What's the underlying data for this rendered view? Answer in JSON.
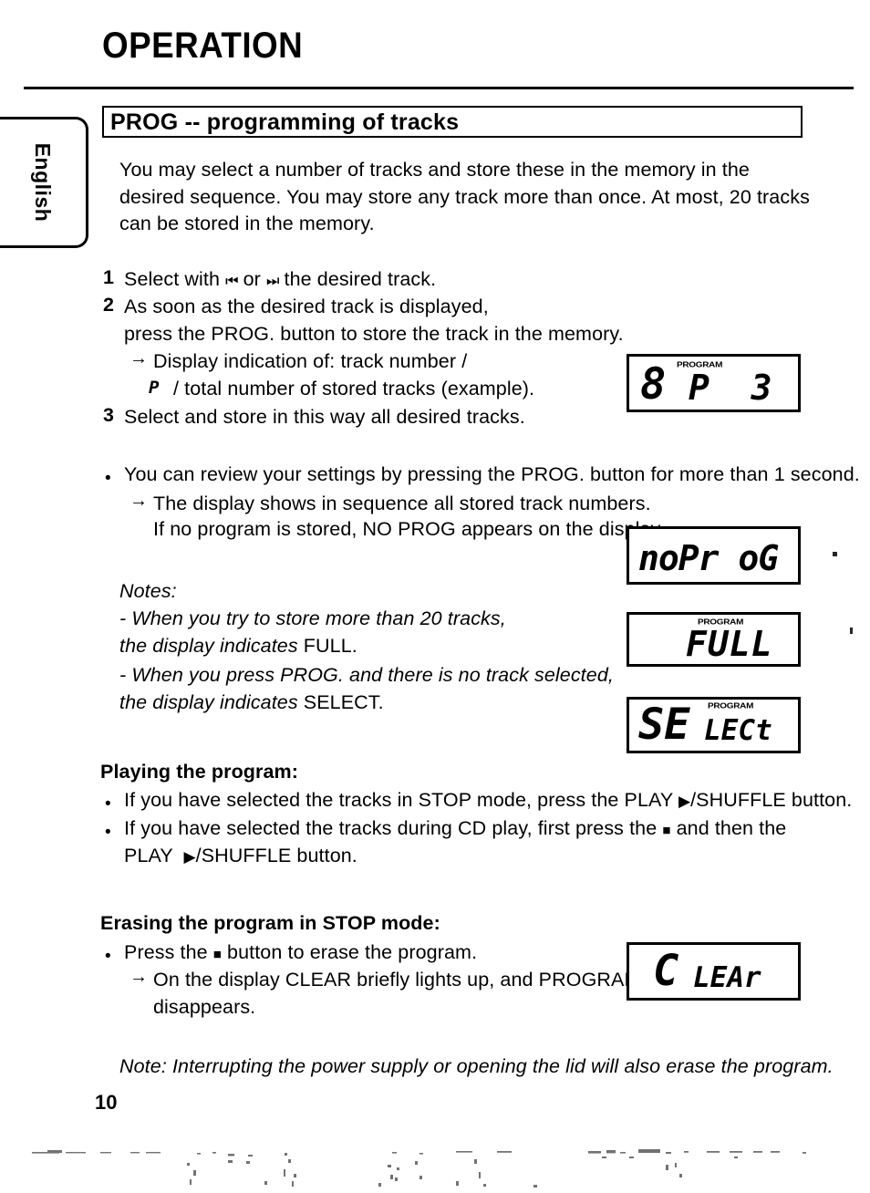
{
  "document": {
    "title": "OPERATION",
    "page_number": "10",
    "language_tab": "English"
  },
  "section": {
    "header": "PROG -- programming of tracks",
    "intro": "You may select a number of tracks and store these in the memory in the desired sequence. You may store any track more than once. At most, 20 tracks can be stored in the memory."
  },
  "steps": [
    {
      "number": "1",
      "line1_a": "Select with ",
      "prev_icon": "⏮",
      "line1_b": " or ",
      "next_icon": "⏭",
      "line1_c": " the desired track."
    },
    {
      "number": "2",
      "line1": "As soon as the desired track is displayed,",
      "line2": "press the PROG. button to store the track in the memory.",
      "sub1_arrow": "→",
      "sub1": "Display indication of: track number /",
      "sub2_lcd": "P",
      "sub2": "/ total number of stored tracks (example)."
    },
    {
      "number": "3",
      "line1": "Select and store in this way all desired tracks."
    }
  ],
  "review": {
    "bullet": "•",
    "line1": "You can review your settings by pressing the PROG. button for more than 1 second.",
    "arrow": "→",
    "line2": "The display shows in sequence all stored track numbers.",
    "line3": "If no program is stored, NO PROG appears on the display."
  },
  "notes": {
    "heading": "Notes:",
    "note1_line1": "- When you try to store more than 20 tracks,",
    "note1_line2_a": "the display indicates ",
    "note1_line2_b": "FULL.",
    "note2_line1": "- When you press PROG. and there is no track selected,",
    "note2_line2_a": "the display indicates ",
    "note2_line2_b": "SELECT."
  },
  "playing": {
    "heading": "Playing the program:",
    "bullet": "•",
    "item1_a": "If you have selected the tracks in STOP mode, press the PLAY ",
    "item1_play": "▶",
    "item1_b": "/SHUFFLE button.",
    "item2_a": "If you have selected the tracks during CD play, first press the ",
    "item2_stop": "■",
    "item2_b": " and then the",
    "item2_line2_a": "PLAY  ",
    "item2_line2_play": "▶",
    "item2_line2_b": "/SHUFFLE button."
  },
  "erasing": {
    "heading": "Erasing the program in STOP mode:",
    "bullet": "•",
    "item1_a": "Press the ",
    "item1_stop": "■",
    "item1_b": " button to erase the program.",
    "arrow": "→",
    "sub_line1": "On the display CLEAR briefly lights up, and PROGRAM",
    "sub_line2": "disappears."
  },
  "final_note": "Note: Interrupting the power supply or opening the lid will also erase the program.",
  "lcd_displays": [
    {
      "id": "track-program-display",
      "program_label": "PROGRAM",
      "digit": "8",
      "text": "P  3"
    },
    {
      "id": "no-program-display",
      "program_label": "",
      "text": "noPr oG"
    },
    {
      "id": "full-display",
      "program_label": "PROGRAM",
      "text": "FULL"
    },
    {
      "id": "select-display",
      "program_label": "PROGRAM",
      "big_text": "SE",
      "small_text": "LECt"
    },
    {
      "id": "clear-display",
      "program_label": "",
      "big_text": "C",
      "small_text": "LEAr"
    }
  ],
  "colors": {
    "ink": "#000000",
    "paper": "#ffffff"
  }
}
